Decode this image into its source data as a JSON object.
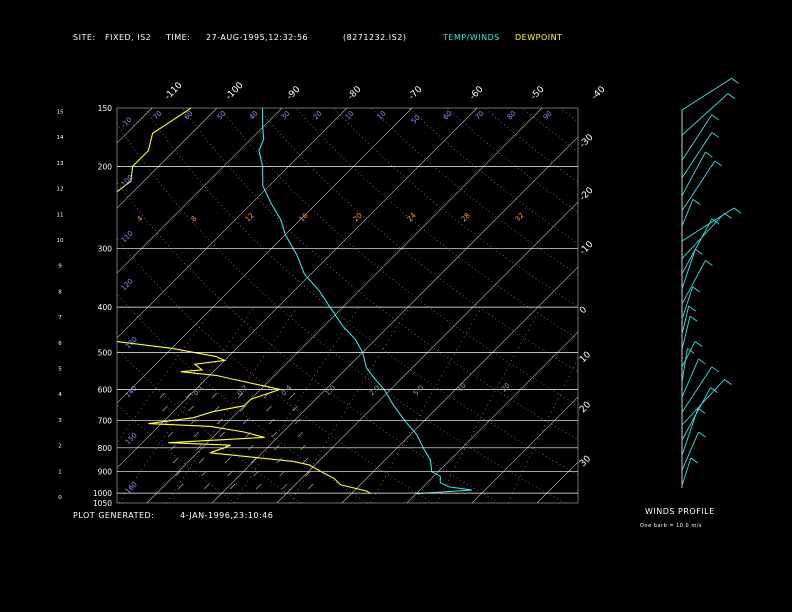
{
  "header": {
    "site_label": "SITE:",
    "site_value": "FIXED, IS2",
    "time_label": "TIME:",
    "time_value": "27-AUG-1995,12:32:56",
    "file_id": "(8271232.IS2)",
    "temp_winds_label": "TEMP/WINDS",
    "dewpoint_label": "DEWPOINT"
  },
  "footer": {
    "generated_label": "PLOT GENERATED:",
    "generated_value": "4-JAN-1996,23:10:46",
    "winds_profile_label": "WINDS PROFILE",
    "barb_note": "One barb = 10.0 m/s"
  },
  "colors": {
    "temp": "#40e0e0",
    "dewpoint": "#ffff40",
    "dry_adiabat": "#9090ff",
    "mixing_ratio": "#ff9a50",
    "isotherm": "#c8c8c8",
    "isobar": "#ffffff",
    "background": "#000000"
  },
  "chart_data": {
    "type": "line",
    "chart_kind": "skew-T log-P thermodynamic diagram with wind profile",
    "y_axis_pressure_mb": {
      "scale": "log",
      "ticks": [
        "150",
        "200",
        "300",
        "400",
        "500",
        "600",
        "700",
        "800",
        "900",
        "1000",
        "1050"
      ],
      "range": [
        1050,
        150
      ]
    },
    "y_axis_height_km": {
      "ticks": [
        "0",
        "1",
        "2",
        "3",
        "4",
        "5",
        "6",
        "7",
        "8",
        "9",
        "10",
        "11",
        "12",
        "13",
        "14",
        "15"
      ]
    },
    "top_temperature_labels": [
      "-110",
      "-100",
      "-90",
      "-80",
      "-70",
      "-60",
      "-50",
      "-40"
    ],
    "right_temperature_labels": [
      "-30",
      "-20",
      "-10",
      "0",
      "10",
      "20",
      "30"
    ],
    "dry_adiabat_labels": [
      "-10",
      "70",
      "60",
      "50",
      "40",
      "30",
      "20",
      "10",
      "10",
      "50",
      "60",
      "70",
      "80",
      "90",
      "100",
      "110",
      "120",
      "130",
      "140",
      "150",
      "160"
    ],
    "mixing_ratio_labels_upper": [
      "4",
      "8",
      "12",
      "16",
      "20",
      "24",
      "28",
      "32"
    ],
    "mixing_ratio_labels_lower": [
      "0.1",
      "0.2",
      "0.4",
      "1.0",
      "2.0",
      "5.0",
      "10",
      "20"
    ],
    "series": [
      {
        "name": "TEMP/WINDS",
        "points_p_t": [
          [
            1003,
            10
          ],
          [
            985,
            18
          ],
          [
            970,
            14
          ],
          [
            950,
            12
          ],
          [
            920,
            11
          ],
          [
            900,
            9
          ],
          [
            850,
            7
          ],
          [
            800,
            4
          ],
          [
            750,
            1
          ],
          [
            700,
            -3
          ],
          [
            650,
            -7
          ],
          [
            600,
            -11
          ],
          [
            570,
            -14
          ],
          [
            540,
            -17
          ],
          [
            500,
            -20
          ],
          [
            470,
            -23
          ],
          [
            440,
            -27
          ],
          [
            400,
            -32
          ],
          [
            370,
            -36
          ],
          [
            340,
            -41
          ],
          [
            310,
            -45
          ],
          [
            280,
            -50
          ],
          [
            260,
            -53
          ],
          [
            240,
            -57
          ],
          [
            220,
            -61
          ],
          [
            200,
            -64
          ],
          [
            185,
            -67
          ],
          [
            175,
            -68
          ],
          [
            165,
            -70
          ],
          [
            150,
            -73
          ]
        ]
      },
      {
        "name": "DEWPOINT",
        "points_p_t": [
          [
            1003,
            3
          ],
          [
            990,
            2
          ],
          [
            960,
            -3
          ],
          [
            930,
            -5
          ],
          [
            900,
            -8
          ],
          [
            870,
            -11
          ],
          [
            855,
            -14
          ],
          [
            845,
            -18
          ],
          [
            820,
            -28
          ],
          [
            790,
            -26
          ],
          [
            780,
            -36
          ],
          [
            760,
            -22
          ],
          [
            740,
            -26
          ],
          [
            720,
            -32
          ],
          [
            710,
            -42
          ],
          [
            690,
            -36
          ],
          [
            670,
            -34
          ],
          [
            650,
            -30
          ],
          [
            630,
            -30
          ],
          [
            600,
            -27
          ],
          [
            580,
            -33
          ],
          [
            570,
            -36
          ],
          [
            560,
            -39
          ],
          [
            550,
            -45
          ],
          [
            545,
            -42
          ],
          [
            530,
            -44
          ],
          [
            520,
            -40
          ],
          [
            510,
            -42
          ],
          [
            490,
            -50
          ],
          [
            470,
            -62
          ],
          [
            440,
            -74
          ],
          [
            420,
            -74
          ],
          [
            400,
            -72
          ],
          [
            370,
            -70
          ],
          [
            340,
            -76
          ],
          [
            320,
            -74
          ],
          [
            300,
            -80
          ],
          [
            270,
            -81
          ],
          [
            240,
            -83
          ],
          [
            215,
            -82
          ],
          [
            200,
            -84
          ],
          [
            185,
            -84
          ],
          [
            170,
            -86
          ],
          [
            160,
            -85
          ],
          [
            150,
            -84
          ]
        ]
      }
    ],
    "wind_profile": {
      "unit": "m/s",
      "barb_value": 10.0,
      "levels": [
        {
          "height_km": 0.1,
          "dir_deg": 20,
          "speed": 10
        },
        {
          "height_km": 0.7,
          "dir_deg": 25,
          "speed": 15
        },
        {
          "height_km": 1.3,
          "dir_deg": 200,
          "speed": 18
        },
        {
          "height_km": 1.9,
          "dir_deg": 210,
          "speed": 22
        },
        {
          "height_km": 2.5,
          "dir_deg": 225,
          "speed": 25
        },
        {
          "height_km": 3.0,
          "dir_deg": 215,
          "speed": 20
        },
        {
          "height_km": 3.6,
          "dir_deg": 25,
          "speed": 15
        },
        {
          "height_km": 4.2,
          "dir_deg": 190,
          "speed": 12
        },
        {
          "height_km": 4.8,
          "dir_deg": 30,
          "speed": 10
        },
        {
          "height_km": 5.5,
          "dir_deg": 15,
          "speed": 12
        },
        {
          "height_km": 6.1,
          "dir_deg": 195,
          "speed": 10
        },
        {
          "height_km": 6.7,
          "dir_deg": 20,
          "speed": 12
        },
        {
          "height_km": 7.3,
          "dir_deg": 210,
          "speed": 18
        },
        {
          "height_km": 7.9,
          "dir_deg": 20,
          "speed": 15
        },
        {
          "height_km": 8.5,
          "dir_deg": 210,
          "speed": 25
        },
        {
          "height_km": 9.1,
          "dir_deg": 225,
          "speed": 28
        },
        {
          "height_km": 9.8,
          "dir_deg": 240,
          "speed": 30
        },
        {
          "height_km": 10.4,
          "dir_deg": 25,
          "speed": 10
        },
        {
          "height_km": 11.0,
          "dir_deg": 215,
          "speed": 22
        },
        {
          "height_km": 11.6,
          "dir_deg": 30,
          "speed": 18
        },
        {
          "height_km": 12.3,
          "dir_deg": 35,
          "speed": 20
        },
        {
          "height_km": 13.0,
          "dir_deg": 215,
          "speed": 20
        },
        {
          "height_km": 14.0,
          "dir_deg": 230,
          "speed": 35
        },
        {
          "height_km": 15.0,
          "dir_deg": 300,
          "speed": 22
        }
      ]
    }
  }
}
